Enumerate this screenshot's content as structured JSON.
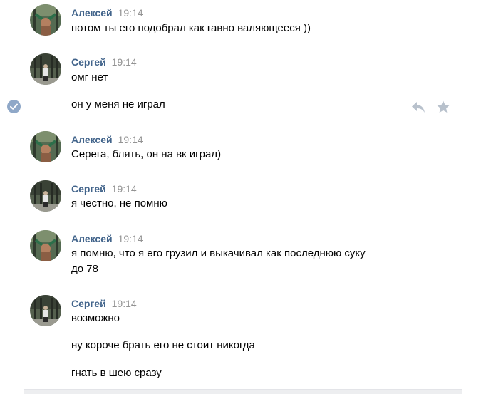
{
  "messages": [
    {
      "author": "Алексей",
      "time": "19:14",
      "lines": [
        "потом ты его подобрал как гавно валяющееся ))"
      ]
    },
    {
      "author": "Сергей",
      "time": "19:14",
      "lines": [
        "омг нет",
        "он у меня не играл"
      ]
    },
    {
      "author": "Алексей",
      "time": "19:14",
      "lines": [
        "Серега, блять, он на вк играл)"
      ]
    },
    {
      "author": "Сергей",
      "time": "19:14",
      "lines": [
        "я честно, не помню"
      ]
    },
    {
      "author": "Алексей",
      "time": "19:14",
      "lines": [
        "я помню, что я его грузил и выкачивал как последнюю суку",
        "до 78"
      ]
    },
    {
      "author": "Сергей",
      "time": "19:14",
      "lines": [
        "возможно",
        "ну короче брать его не стоит никогда",
        "гнать в шею сразу"
      ]
    }
  ],
  "icons": {
    "selected": "check-icon",
    "reply": "reply-icon",
    "favorite": "star-icon"
  },
  "colors": {
    "author": "#42648b",
    "time": "#939393",
    "check": "#8fa8c8",
    "action_icons": "#b8c1cc"
  }
}
